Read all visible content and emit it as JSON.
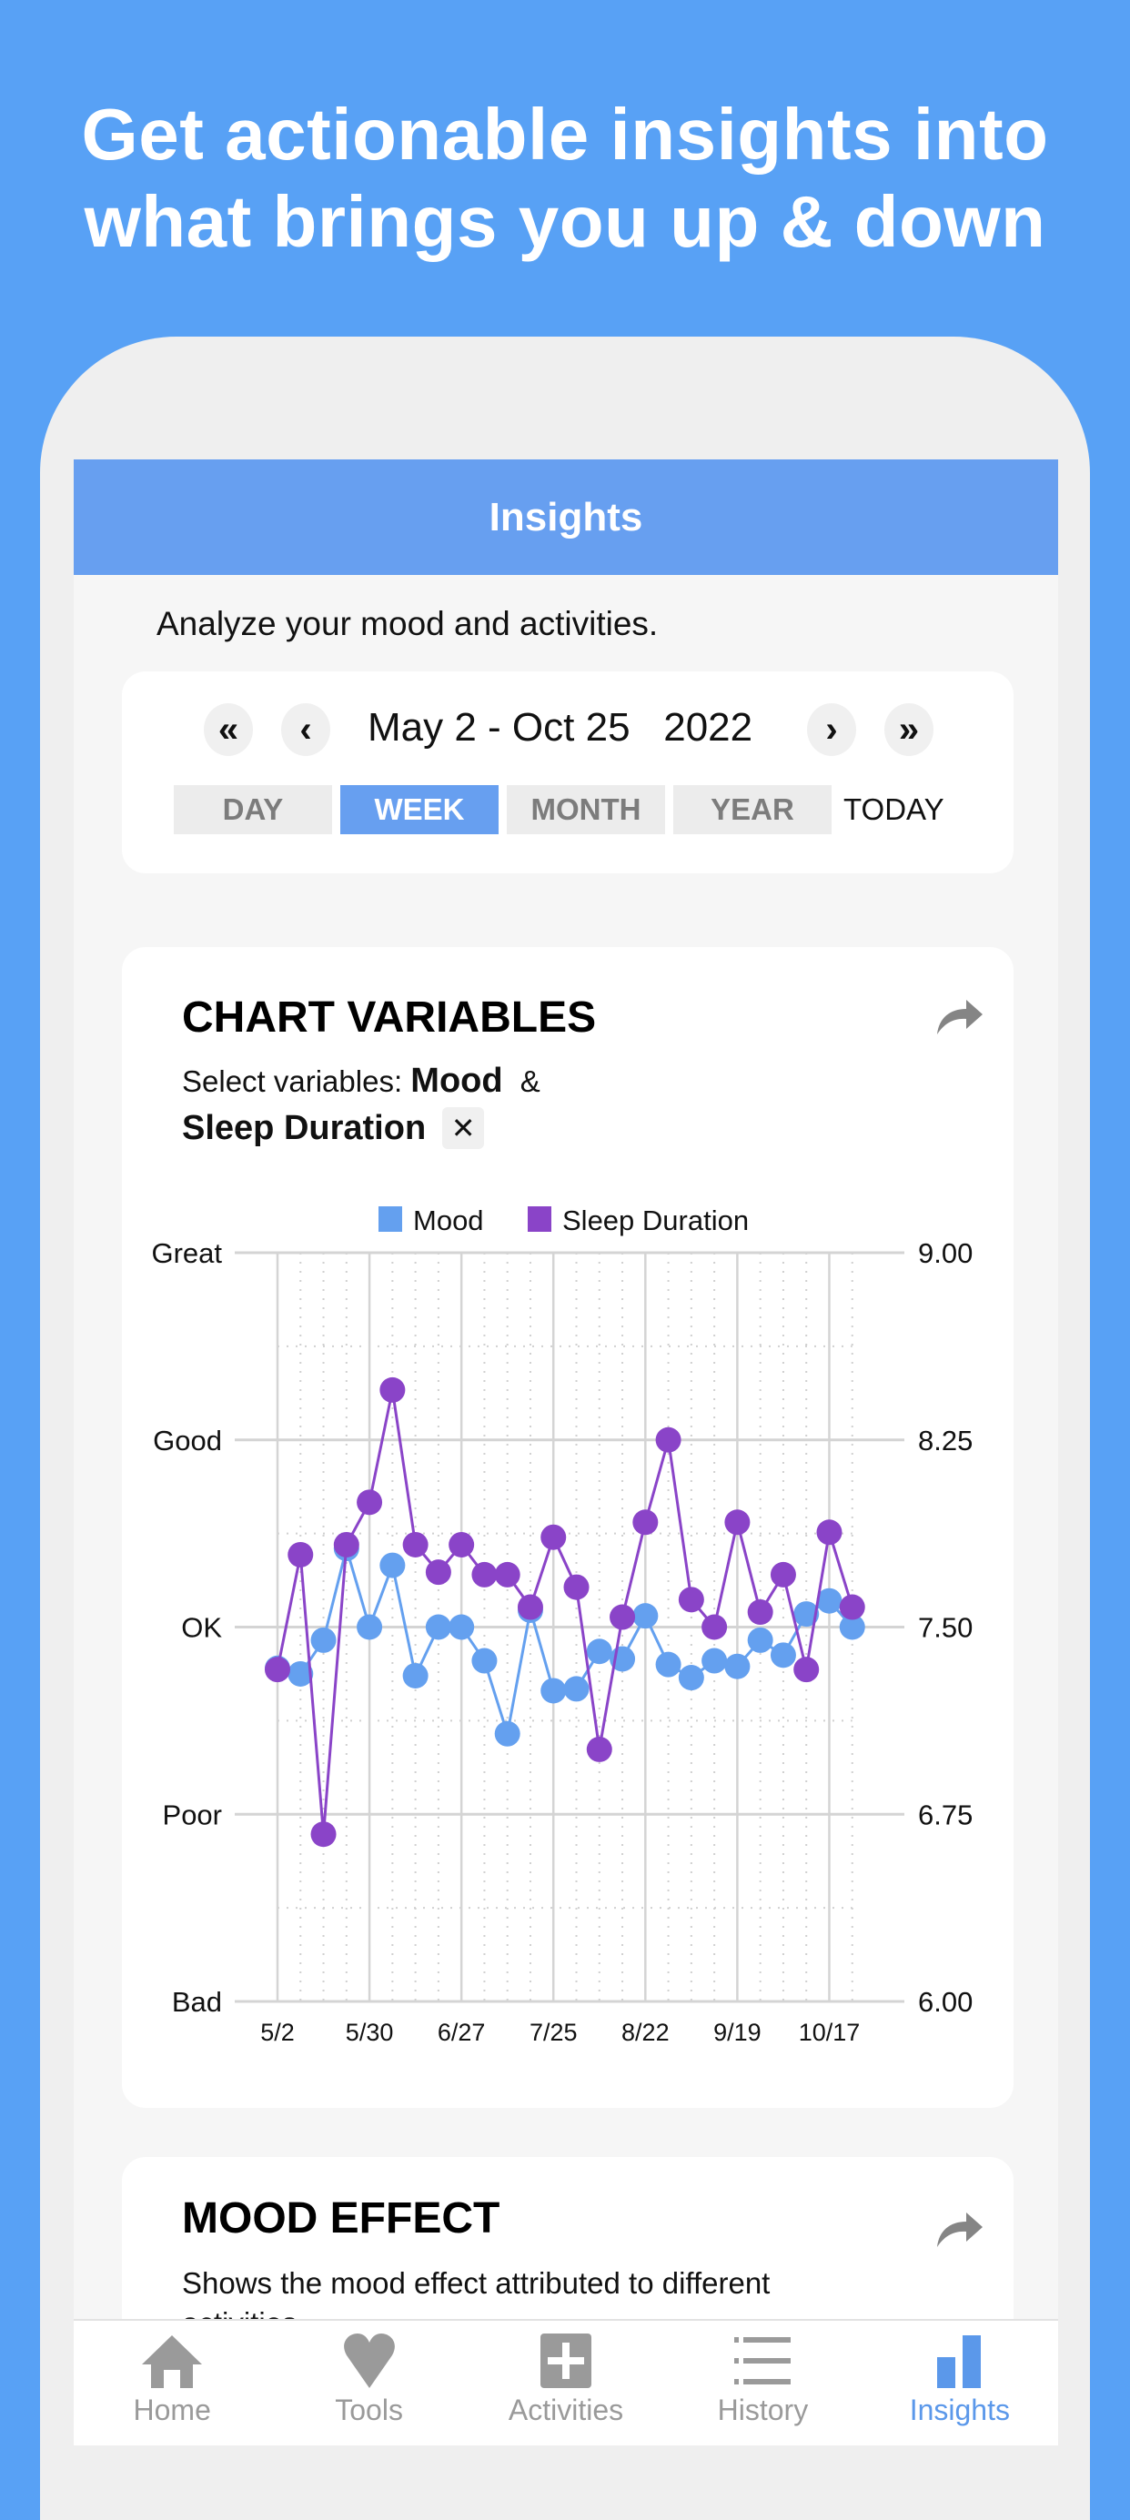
{
  "promo": {
    "headline_line1": "Get actionable insights into",
    "headline_line2": "what brings you up & down"
  },
  "colors": {
    "background": "#58a1f5",
    "accent": "#679ff0",
    "mood": "#64a0ef",
    "sleep": "#8a44c8"
  },
  "header": {
    "title": "Insights"
  },
  "subtitle": "Analyze your mood and activities.",
  "date_nav": {
    "first_icon": "double-chevron-left-icon",
    "prev_icon": "chevron-left-icon",
    "range": "May 2 - Oct 25",
    "year": "2022",
    "next_icon": "chevron-right-icon",
    "last_icon": "double-chevron-right-icon",
    "periods": [
      {
        "label": "DAY",
        "active": false
      },
      {
        "label": "WEEK",
        "active": true
      },
      {
        "label": "MONTH",
        "active": false
      },
      {
        "label": "YEAR",
        "active": false
      }
    ],
    "today_label": "TODAY"
  },
  "chart_card": {
    "title": "CHART VARIABLES",
    "share_icon": "share-arrow-icon",
    "select_label": "Select variables:",
    "variable1": "Mood",
    "joiner": "&",
    "variable2": "Sleep Duration",
    "remove_icon": "close-icon",
    "remove_label": "✕"
  },
  "chart_data": {
    "type": "line",
    "title": "",
    "legend": [
      "Mood",
      "Sleep Duration"
    ],
    "legend_position": "top-center",
    "x": [
      "5/2",
      "5/9",
      "5/16",
      "5/23",
      "5/30",
      "6/6",
      "6/13",
      "6/20",
      "6/27",
      "7/4",
      "7/11",
      "7/18",
      "7/25",
      "8/1",
      "8/8",
      "8/15",
      "8/22",
      "8/29",
      "9/5",
      "9/12",
      "9/19",
      "9/26",
      "10/3",
      "10/10",
      "10/17",
      "10/24"
    ],
    "x_tick_labels": [
      "5/2",
      "5/30",
      "6/27",
      "7/25",
      "8/22",
      "9/19",
      "10/17"
    ],
    "left_axis": {
      "labels": [
        "Bad",
        "Poor",
        "OK",
        "Good",
        "Great"
      ],
      "range": [
        1,
        5
      ]
    },
    "right_axis": {
      "labels": [
        "6.00",
        "6.75",
        "7.50",
        "8.25",
        "9.00"
      ],
      "range": [
        6.0,
        9.0
      ]
    },
    "grid": true,
    "series": [
      {
        "name": "Mood",
        "axis": "left",
        "values": [
          2.78,
          2.75,
          2.93,
          3.42,
          3.0,
          3.33,
          2.74,
          3.0,
          3.0,
          2.82,
          2.43,
          3.09,
          2.66,
          2.67,
          2.87,
          2.83,
          3.06,
          2.8,
          2.73,
          2.82,
          2.79,
          2.93,
          2.85,
          3.07,
          3.14,
          3.0
        ]
      },
      {
        "name": "Sleep Duration",
        "axis": "right",
        "values": [
          7.33,
          7.79,
          6.67,
          7.83,
          8.0,
          8.45,
          7.83,
          7.72,
          7.83,
          7.71,
          7.71,
          7.58,
          7.86,
          7.66,
          7.01,
          7.54,
          7.92,
          8.25,
          7.61,
          7.5,
          7.92,
          7.56,
          7.71,
          7.33,
          7.88,
          7.58
        ]
      }
    ]
  },
  "mood_effect": {
    "title": "MOOD EFFECT",
    "share_icon": "share-arrow-icon",
    "description": "Shows the mood effect attributed to different activities."
  },
  "tabbar": {
    "items": [
      {
        "label": "Home",
        "icon": "home-icon",
        "active": false
      },
      {
        "label": "Tools",
        "icon": "heart-icon",
        "active": false
      },
      {
        "label": "Activities",
        "icon": "plus-square-icon",
        "active": false
      },
      {
        "label": "History",
        "icon": "list-icon",
        "active": false
      },
      {
        "label": "Insights",
        "icon": "bar-chart-icon",
        "active": true
      }
    ]
  }
}
